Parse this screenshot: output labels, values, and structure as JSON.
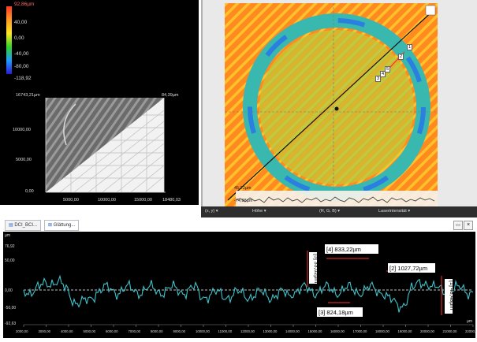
{
  "colorbar": {
    "labels": [
      "92,86µm",
      "40,00",
      "0,00",
      "-40,00",
      "-80,00",
      "-118,92"
    ],
    "colors": [
      "#ff3a22",
      "#ff9a22",
      "#ffe620",
      "#35d22a",
      "#1e9bff",
      "#2d1bd6"
    ]
  },
  "view3d": {
    "top_left": "16743,21µm",
    "top_right": "84,39µm",
    "y_ticks": [
      "10000,00",
      "5000,00",
      "0,00"
    ],
    "x_ticks": [
      "5000,00",
      "10000,00",
      "15000,00",
      "18480,03"
    ]
  },
  "heightmap": {
    "markers": [
      "1",
      "2",
      "3",
      "4",
      "5"
    ],
    "profile_top": "45,22µm",
    "profile_bottom": "-74,88µm",
    "toolbar": [
      "(x, y)",
      "Höhe",
      "(R, G, B)",
      "Laserintensität"
    ]
  },
  "tabs": [
    "DCI_BCI...",
    "Glättung..."
  ],
  "profile_chart": {
    "y_label": "µm",
    "y_ticks": [
      "76,92",
      "50,00",
      "0,00",
      "-50,00",
      "-92,63"
    ],
    "x_ticks": [
      "2000,00",
      "3000,00",
      "4000,00",
      "5000,00",
      "6000,00",
      "7000,00",
      "8000,00",
      "9000,00",
      "10000,00",
      "11000,00",
      "12000,00",
      "13000,00",
      "14000,00",
      "15000,00",
      "16000,00",
      "17000,00",
      "18000,00",
      "19000,00",
      "20000,00",
      "21000,00",
      "22000,00"
    ],
    "x_axis_label": "µm",
    "annotations": [
      {
        "id": "[5]",
        "label": "33,02µm"
      },
      {
        "id": "[4]",
        "label": "833,22µm"
      },
      {
        "id": "[2]",
        "label": "1027,72µm"
      },
      {
        "id": "[3]",
        "label": "824,18µm"
      },
      {
        "id": "[1]",
        "label": "48,48µm"
      }
    ],
    "line_color": "#3fc2c9"
  }
}
